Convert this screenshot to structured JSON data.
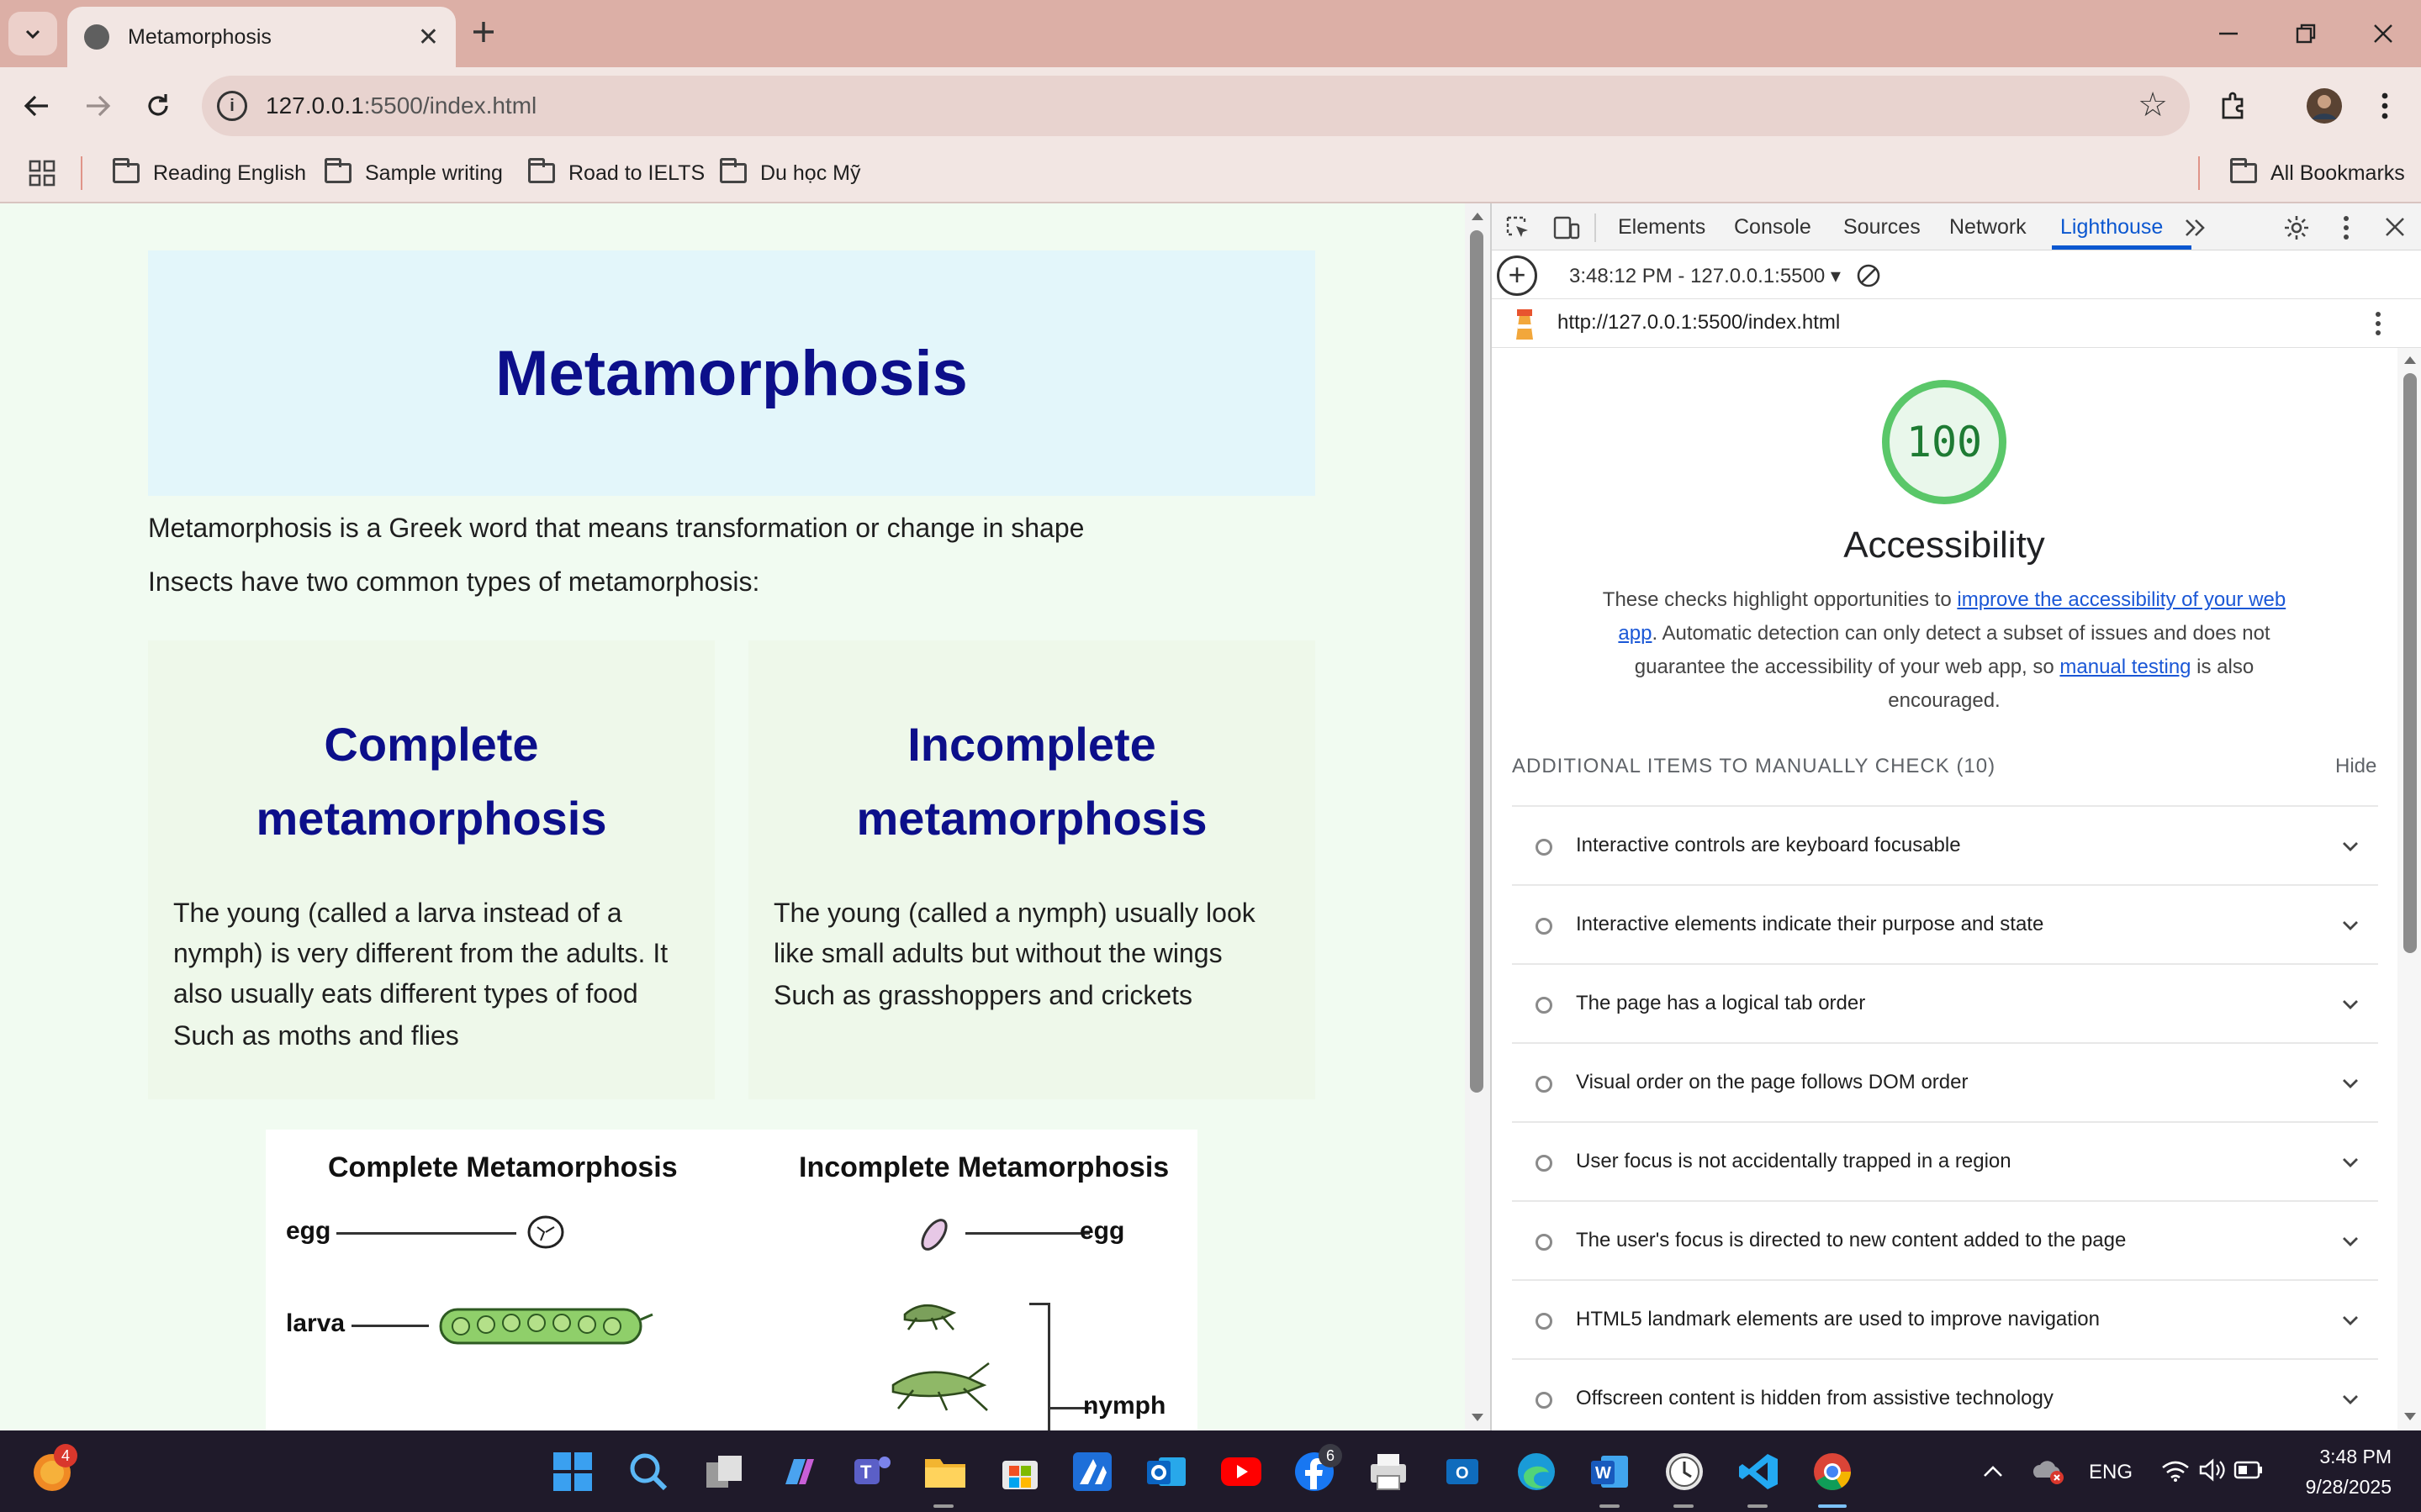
{
  "browser": {
    "tab_title": "Metamorphosis",
    "url_host": "127.0.0.1",
    "url_path": ":5500/index.html",
    "bookmarks": [
      "Reading English",
      "Sample writing",
      "Road to IELTS",
      "Du học Mỹ"
    ],
    "all_bookmarks": "All Bookmarks"
  },
  "page": {
    "title": "Metamorphosis",
    "intro": "Metamorphosis is a Greek word that means transformation or change in shape",
    "types": "Insects have two common types of metamorphosis:",
    "cards": [
      {
        "heading": "Complete metamorphosis",
        "desc": "The young (called a larva instead of a nymph) is very different from the adults. It also usually eats different types of food",
        "example": "Such as moths and flies"
      },
      {
        "heading": "Incomplete metamorphosis",
        "desc": "The young (called a nymph) usually look like small adults but without the wings",
        "example": "Such as grasshoppers and crickets"
      }
    ],
    "diagram": {
      "left_title": "Complete Metamorphosis",
      "right_title": "Incomplete Metamorphosis",
      "left_labels": [
        "egg",
        "larva"
      ],
      "right_labels": [
        "egg",
        "nymph"
      ]
    }
  },
  "devtools": {
    "tabs": [
      "Elements",
      "Console",
      "Sources",
      "Network",
      "Lighthouse"
    ],
    "active_tab": "Lighthouse",
    "report_label": "3:48:12 PM - 127.0.0.1:5500",
    "report_url": "http://127.0.0.1:5500/index.html",
    "score": "100",
    "category": "Accessibility",
    "desc_part1": "These checks highlight opportunities to ",
    "desc_link1": "improve the accessibility of your web app",
    "desc_part2": ". Automatic detection can only detect a subset of issues and does not guarantee the accessibility of your web app, so ",
    "desc_link2": "manual testing",
    "desc_part3": " is also encouraged.",
    "manual_heading": "ADDITIONAL ITEMS TO MANUALLY CHECK (10)",
    "hide_label": "Hide",
    "audits": [
      "Interactive controls are keyboard focusable",
      "Interactive elements indicate their purpose and state",
      "The page has a logical tab order",
      "Visual order on the page follows DOM order",
      "User focus is not accidentally trapped in a region",
      "The user's focus is directed to new content added to the page",
      "HTML5 landmark elements are used to improve navigation",
      "Offscreen content is hidden from assistive technology"
    ],
    "score_color": "#5ac769",
    "link_color": "#1a57d6"
  },
  "taskbar": {
    "notification_count": "4",
    "facebook_count": "6",
    "language": "ENG",
    "time": "3:48 PM",
    "date": "9/28/2025"
  },
  "icons": [
    "tab-list-icon",
    "globe-icon",
    "close-icon",
    "plus-icon",
    "minimize-icon",
    "restore-icon",
    "back-icon",
    "forward-icon",
    "reload-icon",
    "info-icon",
    "star-icon",
    "extensions-icon",
    "avatar",
    "kebab-icon",
    "apps-icon",
    "folder-icon",
    "gear-icon",
    "chevron-down-icon"
  ]
}
